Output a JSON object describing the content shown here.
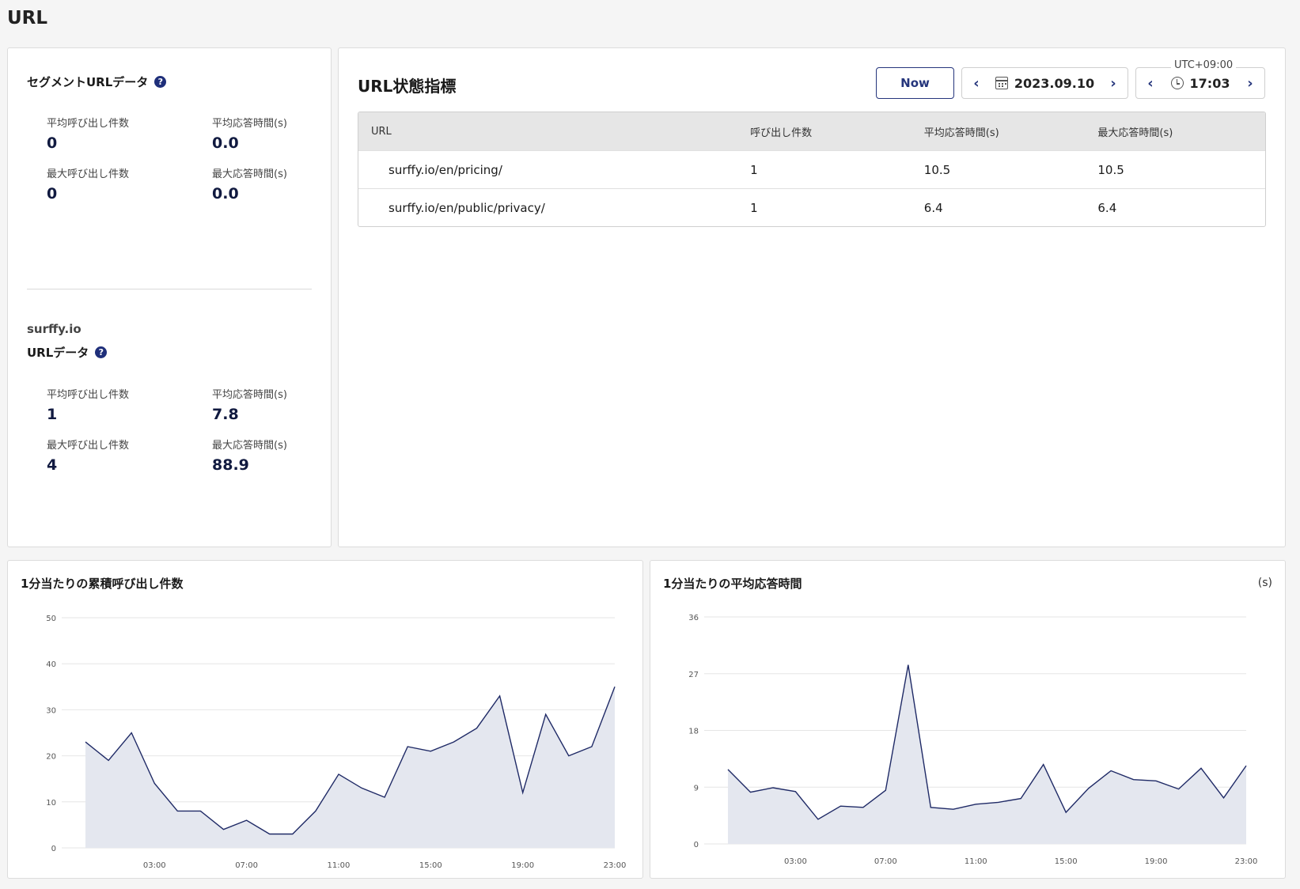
{
  "page": {
    "title": "URL"
  },
  "segment": {
    "heading": "セグメントURLデータ",
    "metrics": [
      {
        "label": "平均呼び出し件数",
        "value": "0"
      },
      {
        "label": "平均応答時間(s)",
        "value": "0.0"
      },
      {
        "label": "最大呼び出し件数",
        "value": "0"
      },
      {
        "label": "最大応答時間(s)",
        "value": "0.0"
      }
    ]
  },
  "domain": {
    "name": "surffy.io",
    "heading": "URLデータ",
    "metrics": [
      {
        "label": "平均呼び出し件数",
        "value": "1"
      },
      {
        "label": "平均応答時間(s)",
        "value": "7.8"
      },
      {
        "label": "最大呼び出し件数",
        "value": "4"
      },
      {
        "label": "最大応答時間(s)",
        "value": "88.9"
      }
    ]
  },
  "url_status": {
    "title": "URL状態指標",
    "now_label": "Now",
    "date": "2023.09.10",
    "time": "17:03",
    "timezone": "UTC+09:00",
    "columns": [
      "URL",
      "呼び出し件数",
      "平均応答時間(s)",
      "最大応答時間(s)"
    ],
    "rows": [
      [
        "surffy.io/en/pricing/",
        "1",
        "10.5",
        "10.5"
      ],
      [
        "surffy.io/en/public/privacy/",
        "1",
        "6.4",
        "6.4"
      ]
    ]
  },
  "chart_data": [
    {
      "type": "area",
      "title": "1分当たりの累積呼び出し件数",
      "ylim": [
        0,
        50
      ],
      "yticks": [
        0,
        10,
        20,
        30,
        40,
        50
      ],
      "xtick_labels": [
        "03:00",
        "07:00",
        "11:00",
        "15:00",
        "19:00",
        "23:00"
      ],
      "grid": true,
      "series": [
        {
          "values": [
            23,
            19,
            25,
            14,
            8,
            8,
            4,
            6,
            3,
            3,
            8,
            16,
            13,
            11,
            22,
            21,
            23,
            26,
            33,
            12,
            29,
            20,
            22,
            35
          ]
        }
      ],
      "color": "#1f2a66"
    },
    {
      "type": "area",
      "title": "1分当たりの平均応答時間",
      "unit": "(s)",
      "ylim": [
        0,
        36
      ],
      "yticks": [
        0,
        9,
        18,
        27,
        36
      ],
      "xtick_labels": [
        "03:00",
        "07:00",
        "11:00",
        "15:00",
        "19:00",
        "23:00"
      ],
      "grid": true,
      "series": [
        {
          "values": [
            11.8,
            8.2,
            8.9,
            8.3,
            3.9,
            6.0,
            5.8,
            8.5,
            28.4,
            5.8,
            5.5,
            6.3,
            6.6,
            7.2,
            12.6,
            5.0,
            8.8,
            11.6,
            10.2,
            10.0,
            8.7,
            12.0,
            7.3,
            12.4
          ]
        }
      ],
      "color": "#1f2a66"
    }
  ]
}
